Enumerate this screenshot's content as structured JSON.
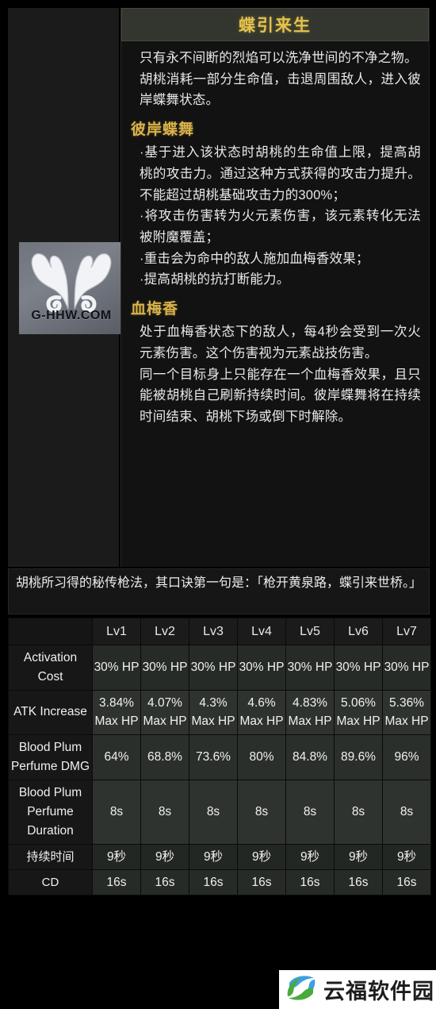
{
  "skill": {
    "title": "蝶引来生",
    "icon_name": "butterfly-skill-icon",
    "icon_watermark": "G-HHW.COM",
    "description_paragraphs": [
      "只有永不间断的烈焰可以洗净世间的不净之物。",
      "胡桃消耗一部分生命值，击退周围敌人，进入彼岸蝶舞状态。"
    ],
    "sections": [
      {
        "heading": "彼岸蝶舞",
        "bullets": [
          "·基于进入该状态时胡桃的生命值上限，提高胡桃的攻击力。通过这种方式获得的攻击力提升。不能超过胡桃基础攻击力的300%；",
          "·将攻击伤害转为火元素伤害，该元素转化无法被附魔覆盖；",
          "·重击会为命中的敌人施加血梅香效果；",
          "·提高胡桃的抗打断能力。"
        ]
      },
      {
        "heading": "血梅香",
        "bullets": [
          "处于血梅香状态下的敌人，每4秒会受到一次火元素伤害。这个伤害视为元素战技伤害。",
          "同一个目标身上只能存在一个血梅香效果，且只能被胡桃自己刷新持续时间。彼岸蝶舞将在持续时间结束、胡桃下场或倒下时解除。"
        ]
      }
    ],
    "flavor_quote": "胡桃所习得的秘传枪法，其口诀第一句是：「枪开黄泉路，蝶引来世桥。」"
  },
  "table": {
    "corner_label": "",
    "level_headers": [
      "Lv1",
      "Lv2",
      "Lv3",
      "Lv4",
      "Lv5",
      "Lv6",
      "Lv7"
    ],
    "rows": [
      {
        "label": "Activation Cost",
        "values": [
          "30% HP",
          "30% HP",
          "30% HP",
          "30% HP",
          "30% HP",
          "30% HP",
          "30% HP"
        ]
      },
      {
        "label": "ATK Increase",
        "values": [
          "3.84% Max HP",
          "4.07% Max HP",
          "4.3% Max HP",
          "4.6% Max HP",
          "4.83% Max HP",
          "5.06% Max HP",
          "5.36% Max HP"
        ]
      },
      {
        "label": "Blood Plum Perfume DMG",
        "values": [
          "64%",
          "68.8%",
          "73.6%",
          "80%",
          "84.8%",
          "89.6%",
          "96%"
        ]
      },
      {
        "label": "Blood Plum Perfume Duration",
        "values": [
          "8s",
          "8s",
          "8s",
          "8s",
          "8s",
          "8s",
          "8s"
        ]
      },
      {
        "label": "持续时间",
        "values": [
          "9秒",
          "9秒",
          "9秒",
          "9秒",
          "9秒",
          "9秒",
          "9秒"
        ]
      },
      {
        "label": "CD",
        "values": [
          "16s",
          "16s",
          "16s",
          "16s",
          "16s",
          "16s",
          "16s"
        ]
      }
    ]
  },
  "watermark": {
    "text": "云福软件园",
    "logo_name": "yunfu-leaf-logo",
    "logo_colors": {
      "blue": "#3fa0dc",
      "green": "#49ab3c"
    }
  },
  "colors": {
    "title_text": "#e6c24c",
    "section_heading": "#d8b24a",
    "body_text": "#e8e8e8",
    "title_bar_bg": "#32362e",
    "panel_bg": "#121212",
    "cell_bg": "#2c302c",
    "label_bg": "#171717"
  }
}
